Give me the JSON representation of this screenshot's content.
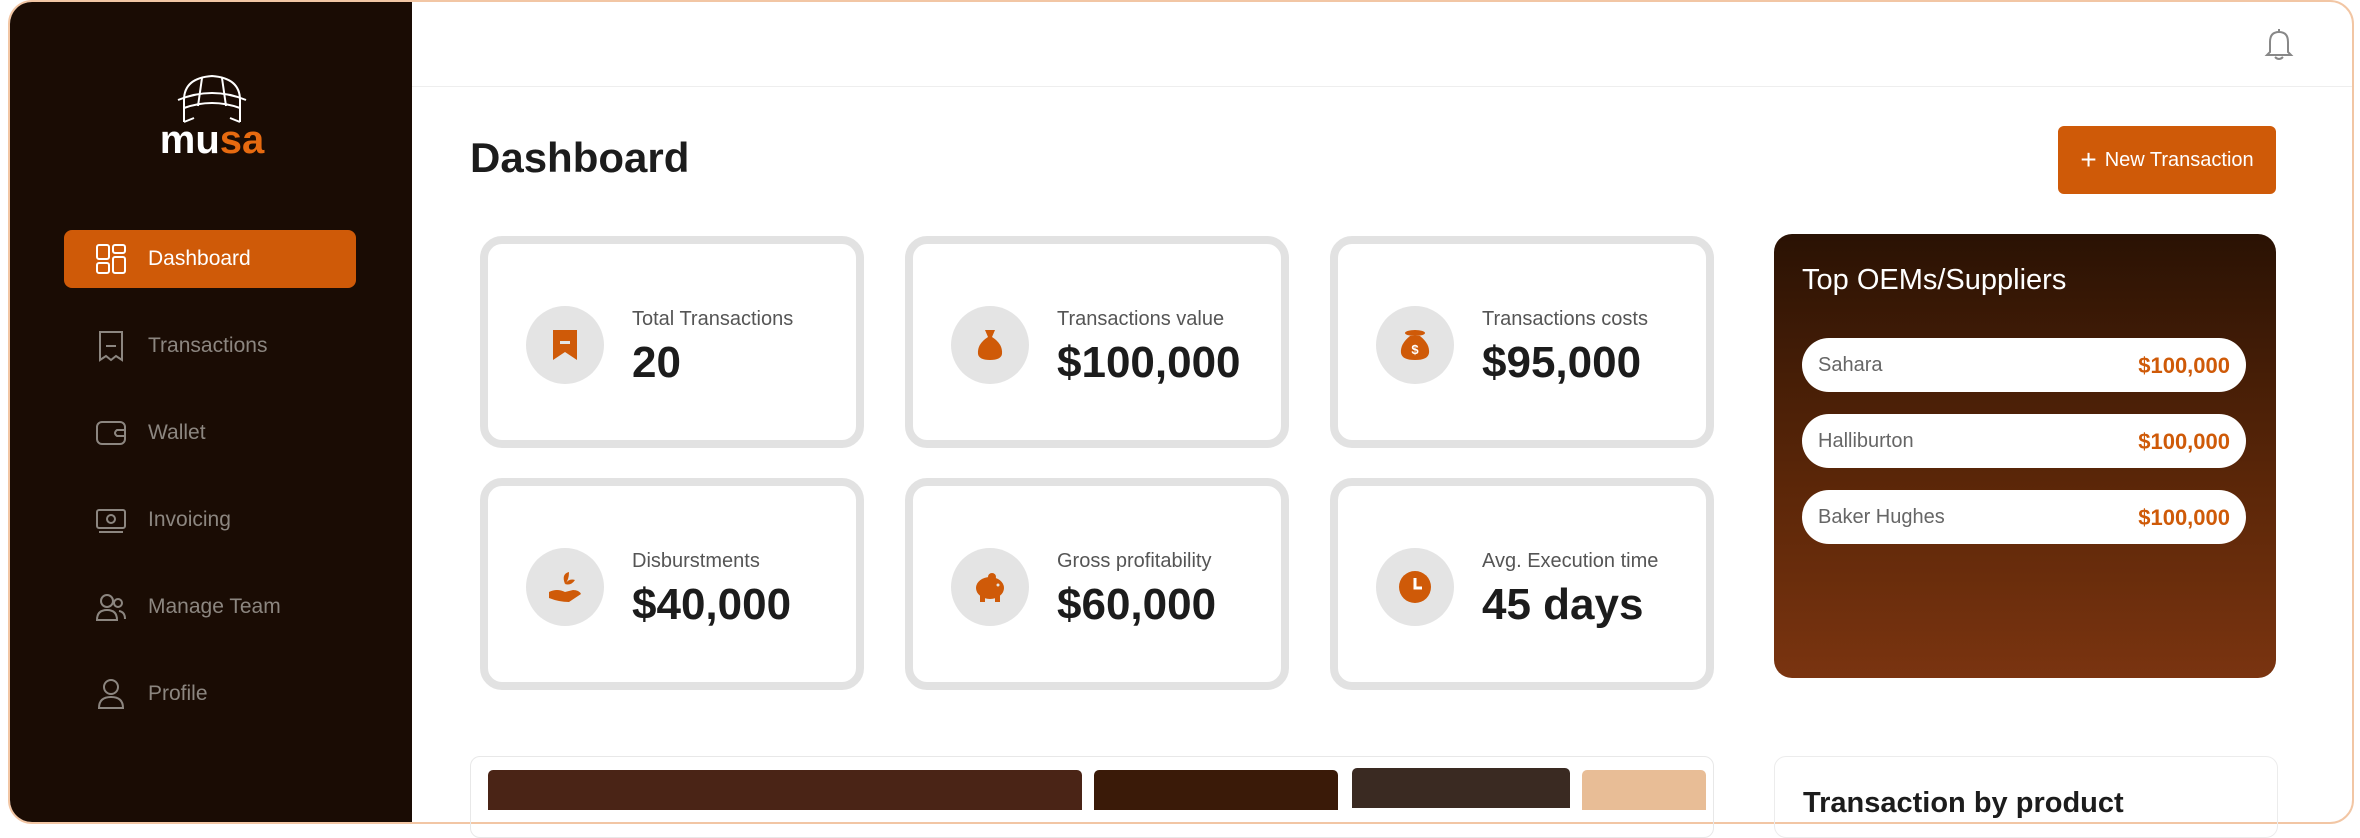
{
  "brand": {
    "logo_white": "mu",
    "logo_orange": "sa",
    "accent_color": "#cf5a08",
    "sidebar_color": "#1a0c04"
  },
  "sidebar": {
    "items": [
      {
        "label": "Dashboard",
        "icon": "dashboard-grid-icon",
        "active": true
      },
      {
        "label": "Transactions",
        "icon": "receipt-icon",
        "active": false
      },
      {
        "label": "Wallet",
        "icon": "wallet-icon",
        "active": false
      },
      {
        "label": "Invoicing",
        "icon": "invoice-cash-icon",
        "active": false
      },
      {
        "label": "Manage Team",
        "icon": "team-icon",
        "active": false
      },
      {
        "label": "Profile",
        "icon": "user-icon",
        "active": false
      }
    ]
  },
  "header": {
    "notification_icon": "bell-icon"
  },
  "main": {
    "title": "Dashboard",
    "new_transaction_label": "New Transaction",
    "stats": [
      {
        "label": "Total Transactions",
        "value": "20",
        "icon": "receipt-icon"
      },
      {
        "label": "Transactions value",
        "value": "$100,000",
        "icon": "money-bag-icon"
      },
      {
        "label": "Transactions costs",
        "value": "$95,000",
        "icon": "dollar-bag-icon"
      },
      {
        "label": "Disburstments",
        "value": "$40,000",
        "icon": "hand-plant-icon"
      },
      {
        "label": "Gross profitability",
        "value": "$60,000",
        "icon": "piggy-bank-icon"
      },
      {
        "label": "Avg. Execution time",
        "value": "45 days",
        "icon": "clock-icon"
      }
    ]
  },
  "top_oems": {
    "title": "Top OEMs/Suppliers",
    "rows": [
      {
        "name": "Sahara",
        "value": "$100,000"
      },
      {
        "name": "Halliburton",
        "value": "$100,000"
      },
      {
        "name": "Baker Hughes",
        "value": "$100,000"
      }
    ]
  },
  "product_panel": {
    "title": "Transaction by product"
  },
  "palette_swatches": [
    "#4a2416",
    "#3a1a08",
    "#3a2a22",
    "#e8bd96"
  ]
}
